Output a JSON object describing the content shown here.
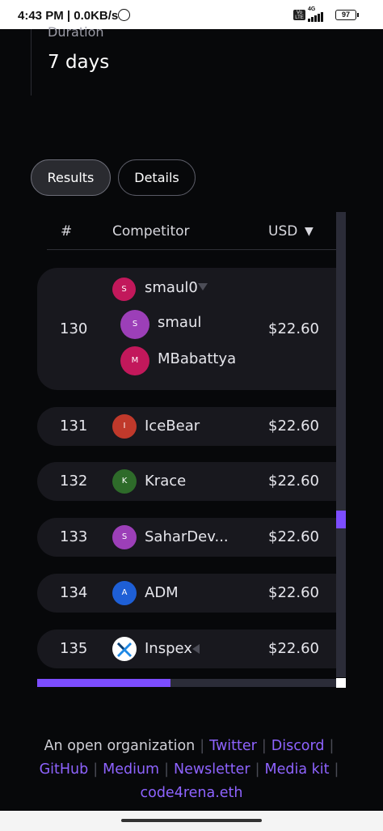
{
  "status_bar": {
    "time": "4:43 PM | 0.0KB/s",
    "network": "4G",
    "volte": "Vo LTE",
    "battery": "97"
  },
  "duration": {
    "label": "Duration",
    "value": "7 days"
  },
  "tabs": [
    {
      "label": "Results",
      "active": true
    },
    {
      "label": "Details",
      "active": false
    }
  ],
  "table": {
    "headers": {
      "rank": "#",
      "competitor": "Competitor",
      "usd": "USD"
    },
    "sort_indicator": "▼",
    "rows": [
      {
        "rank": "130",
        "team": {
          "name": "smaul0",
          "initial": "S",
          "color": "#c2185b"
        },
        "members": [
          {
            "name": "smaul",
            "initial": "S",
            "color": "#9c3fb8"
          },
          {
            "name": "MBabattya",
            "initial": "M",
            "color": "#c2185b"
          }
        ],
        "usd": "$22.60"
      },
      {
        "rank": "131",
        "competitor": {
          "name": "IceBear",
          "initial": "I",
          "color": "#c0392b"
        },
        "usd": "$22.60"
      },
      {
        "rank": "132",
        "competitor": {
          "name": "Krace",
          "initial": "K",
          "color": "#2e6b2a"
        },
        "usd": "$22.60"
      },
      {
        "rank": "133",
        "competitor": {
          "name": "SaharDev...",
          "initial": "S",
          "color": "#9c3fb8"
        },
        "usd": "$22.60"
      },
      {
        "rank": "134",
        "competitor": {
          "name": "ADM",
          "initial": "A",
          "color": "#1e5fd6"
        },
        "usd": "$22.60"
      },
      {
        "rank": "135",
        "competitor": {
          "name": "Inspex",
          "icon": "inspex-logo-icon"
        },
        "usd": "$22.60"
      }
    ]
  },
  "footer": {
    "tagline": "An open organization",
    "links": [
      "Twitter",
      "Discord",
      "GitHub",
      "Medium",
      "Newsletter",
      "Media kit",
      "code4rena.eth"
    ],
    "link_color": "#8e63ff"
  },
  "colors": {
    "accent": "#7c4dff",
    "background": "#07080a",
    "row_bg": "#18181e"
  }
}
